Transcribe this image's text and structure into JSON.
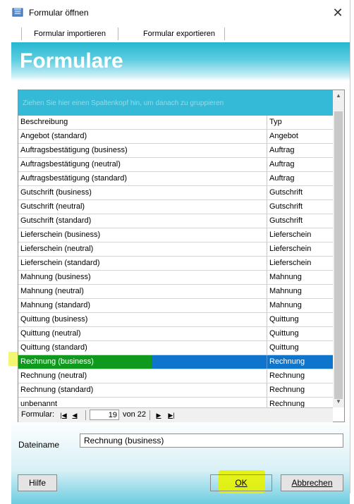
{
  "window": {
    "title": "Formular öffnen",
    "icon": "form-book-icon",
    "close_glyph": "✕"
  },
  "menu": {
    "items": [
      "Formular importieren",
      "Formular exportieren"
    ]
  },
  "banner": {
    "title": "Formulare"
  },
  "grid": {
    "group_hint": "Ziehen Sie hier einen Spaltenkopf hin, um danach zu gruppieren",
    "columns": [
      "Beschreibung",
      "Typ"
    ],
    "rows": [
      [
        "Angebot (standard)",
        "Angebot"
      ],
      [
        "Auftragsbestätigung (business)",
        "Auftrag"
      ],
      [
        "Auftragsbestätigung (neutral)",
        "Auftrag"
      ],
      [
        "Auftragsbestätigung (standard)",
        "Auftrag"
      ],
      [
        "Gutschrift (business)",
        "Gutschrift"
      ],
      [
        "Gutschrift (neutral)",
        "Gutschrift"
      ],
      [
        "Gutschrift (standard)",
        "Gutschrift"
      ],
      [
        "Lieferschein (business)",
        "Lieferschein"
      ],
      [
        "Lieferschein (neutral)",
        "Lieferschein"
      ],
      [
        "Lieferschein (standard)",
        "Lieferschein"
      ],
      [
        "Mahnung (business)",
        "Mahnung"
      ],
      [
        "Mahnung (neutral)",
        "Mahnung"
      ],
      [
        "Mahnung (standard)",
        "Mahnung"
      ],
      [
        "Quittung (business)",
        "Quittung"
      ],
      [
        "Quittung (neutral)",
        "Quittung"
      ],
      [
        "Quittung (standard)",
        "Quittung"
      ],
      [
        "Rechnung (business)",
        "Rechnung"
      ],
      [
        "Rechnung (neutral)",
        "Rechnung"
      ],
      [
        "Rechnung (standard)",
        "Rechnung"
      ],
      [
        "unbenannt",
        "Rechnung"
      ]
    ],
    "selected_index": 16
  },
  "pager": {
    "label": "Formular:",
    "first": "|◀",
    "prev": "◀",
    "next": "▶",
    "last": "▶|",
    "current": "19",
    "of_text": "von 22"
  },
  "filename": {
    "label": "Dateiname",
    "value": "Rechnung (business)"
  },
  "buttons": {
    "help": "Hilfe",
    "ok": "OK",
    "cancel": "Abbrechen"
  },
  "colors": {
    "banner": "#26b7cf",
    "selection": "#0f75cc",
    "selection_mark": "#0f9a1e",
    "highlight": "#e7f200"
  }
}
